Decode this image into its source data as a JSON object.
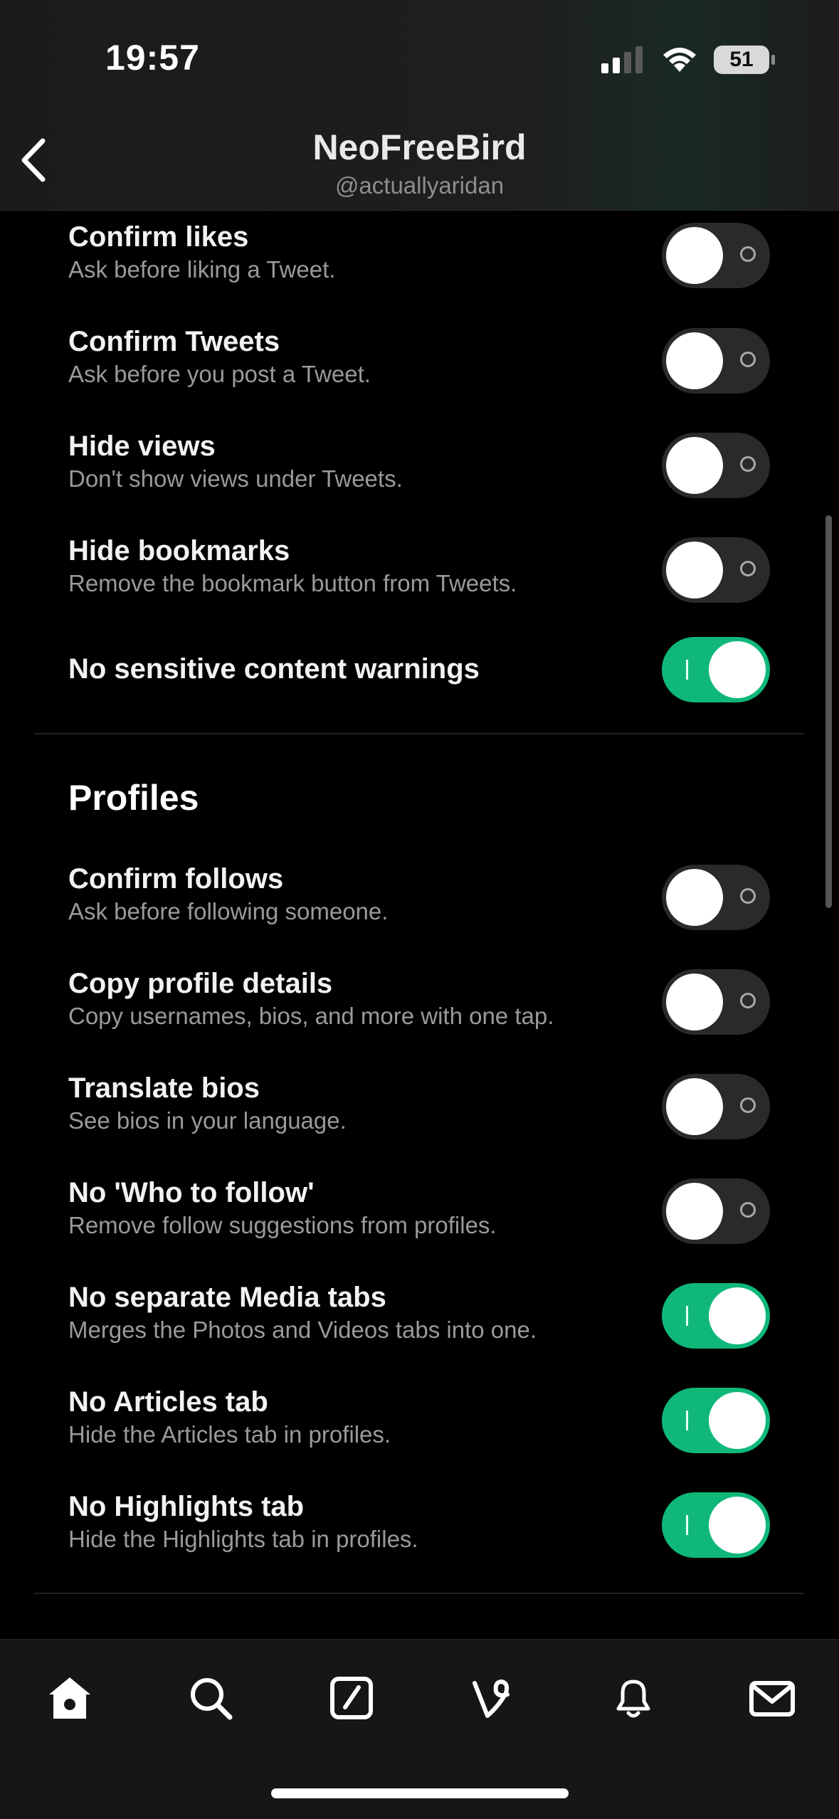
{
  "status": {
    "time": "19:57",
    "battery": "51"
  },
  "header": {
    "title": "NeoFreeBird",
    "handle": "@actuallyaridan"
  },
  "tweets_settings": [
    {
      "title": "Confirm likes",
      "desc": "Ask before liking a Tweet.",
      "on": false
    },
    {
      "title": "Confirm Tweets",
      "desc": "Ask before you post a Tweet.",
      "on": false
    },
    {
      "title": "Hide views",
      "desc": "Don't show views under Tweets.",
      "on": false
    },
    {
      "title": "Hide bookmarks",
      "desc": "Remove the bookmark button from Tweets.",
      "on": false
    },
    {
      "title": "No sensitive content warnings",
      "desc": "",
      "on": true
    }
  ],
  "profiles": {
    "heading": "Profiles",
    "settings": [
      {
        "title": "Confirm follows",
        "desc": "Ask before following someone.",
        "on": false
      },
      {
        "title": "Copy profile details",
        "desc": "Copy usernames, bios, and more with one tap.",
        "on": false
      },
      {
        "title": "Translate bios",
        "desc": "See bios in your language.",
        "on": false
      },
      {
        "title": "No 'Who to follow'",
        "desc": "Remove follow suggestions from profiles.",
        "on": false
      },
      {
        "title": "No separate Media tabs",
        "desc": "Merges the Photos and Videos tabs into one.",
        "on": true
      },
      {
        "title": "No Articles tab",
        "desc": "Hide the Articles tab in profiles.",
        "on": true
      },
      {
        "title": "No Highlights tab",
        "desc": "Hide the Highlights tab in profiles.",
        "on": true
      }
    ]
  },
  "tabbar": [
    "home-icon",
    "search-icon",
    "compose-icon",
    "vine-icon",
    "notifications-icon",
    "messages-icon"
  ],
  "colors": {
    "toggle_on": "#0fb879",
    "toggle_off": "#2a2a2b",
    "background": "#000000"
  }
}
